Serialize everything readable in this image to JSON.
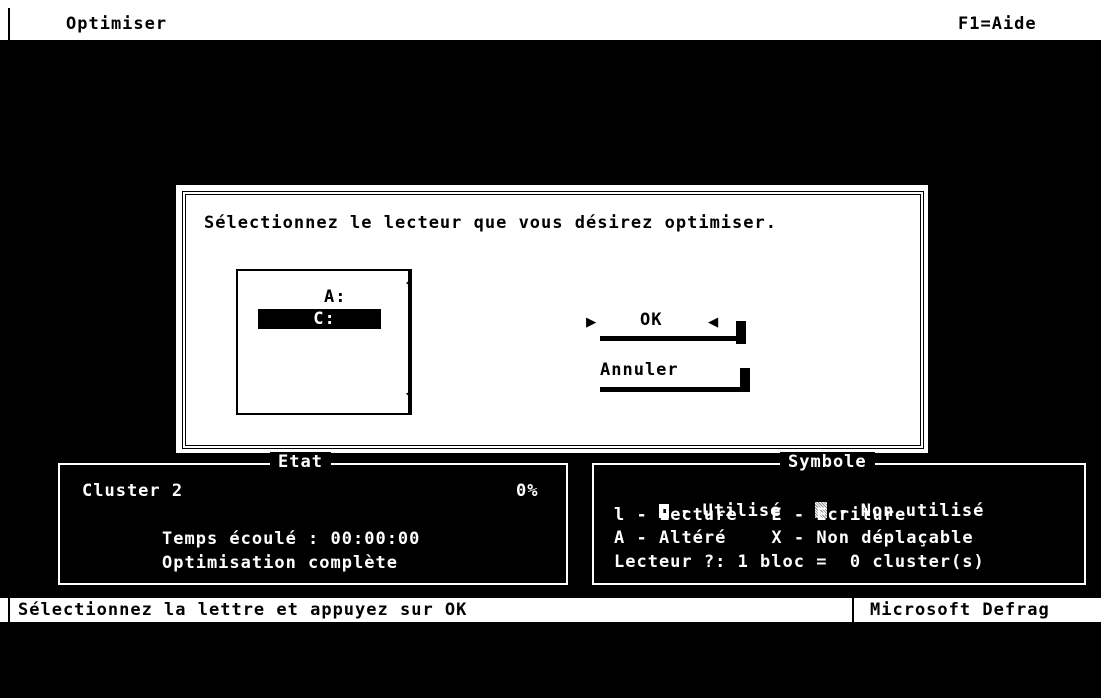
{
  "header": {
    "title": "Optimiser",
    "help": "F1=Aide"
  },
  "dialog": {
    "prompt": "Sélectionnez le lecteur que vous désirez optimiser.",
    "drives": [
      "A:",
      "C:"
    ],
    "selected_drive": "C:",
    "ok_label": "OK",
    "cancel_label": "Annuler"
  },
  "etat": {
    "title": "Etat",
    "cluster": "Cluster 2",
    "percent": "0%",
    "elapsed": "Temps écoulé : 00:00:00",
    "status": "Optimisation complète"
  },
  "symbole": {
    "title": "Symbole",
    "used": "- Utilisé",
    "unused": "- Non utilisé",
    "read_key": "l",
    "read": "- Lecture",
    "write_key": "E",
    "write": "- Ecriture",
    "damaged_key": "A",
    "damaged": "- Altéré",
    "fixed_key": "X",
    "fixed": "- Non déplaçable",
    "scale": "Lecteur ?: 1 bloc =  0 cluster(s)"
  },
  "footer": {
    "hint": "Sélectionnez la lettre et appuyez sur OK",
    "app": "Microsoft Defrag"
  },
  "colors": {
    "background": "#000000",
    "foreground": "#ffffff",
    "accent": "#aaaaaa"
  }
}
